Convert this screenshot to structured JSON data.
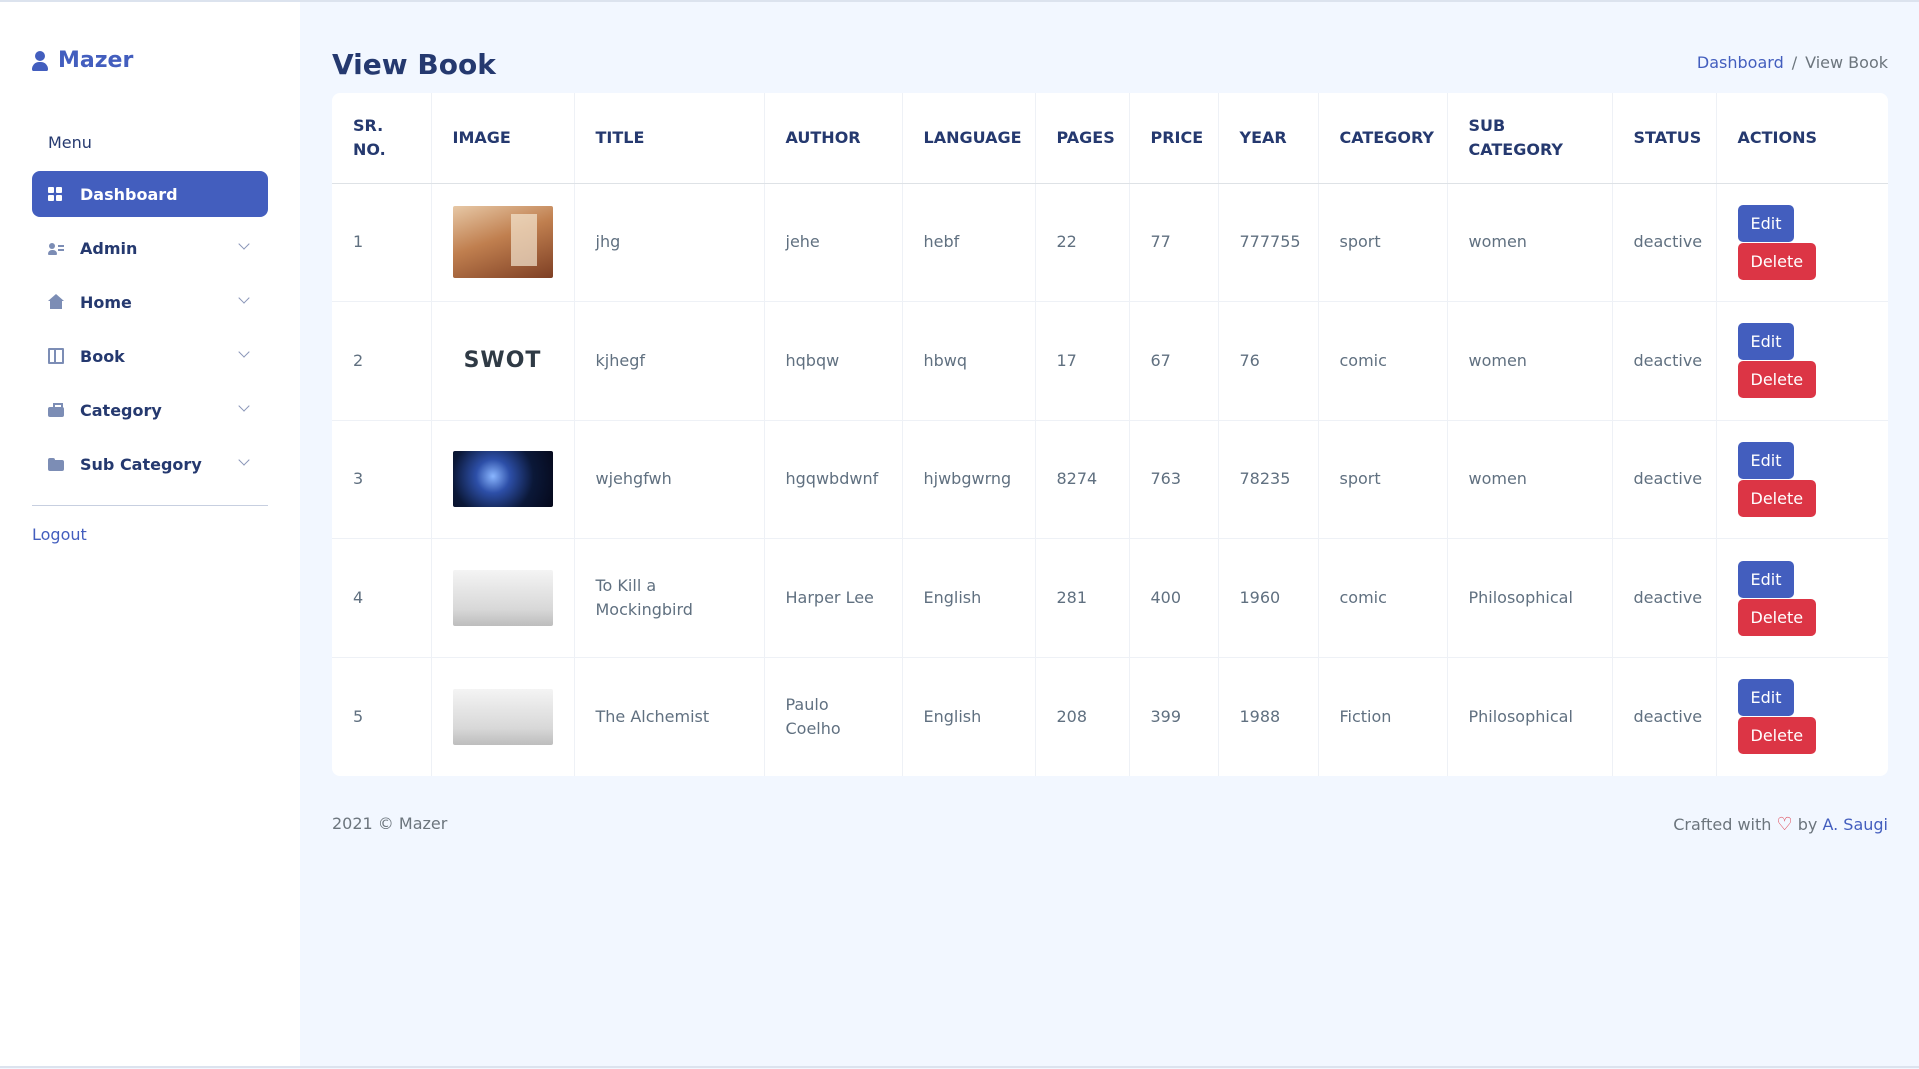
{
  "brand": {
    "name": "Mazer"
  },
  "sidebar": {
    "menu_title": "Menu",
    "items": [
      {
        "label": "Dashboard",
        "icon": "grid-icon",
        "active": true
      },
      {
        "label": "Admin",
        "icon": "admin-icon"
      },
      {
        "label": "Home",
        "icon": "home-icon"
      },
      {
        "label": "Book",
        "icon": "book-icon"
      },
      {
        "label": "Category",
        "icon": "briefcase-icon"
      },
      {
        "label": "Sub Category",
        "icon": "folder-icon"
      }
    ],
    "logout": "Logout"
  },
  "page": {
    "title": "View Book",
    "breadcrumb": {
      "home": "Dashboard",
      "current": "View Book"
    }
  },
  "table": {
    "headers": [
      "SR. NO.",
      "IMAGE",
      "TITLE",
      "AUTHOR",
      "LANGUAGE",
      "PAGES",
      "PRICE",
      "YEAR",
      "CATEGORY",
      "SUB CATEGORY",
      "STATUS",
      "ACTIONS"
    ],
    "edit_label": "Edit",
    "delete_label": "Delete",
    "rows": [
      {
        "sr": "1",
        "image": "room-photo",
        "title": "jhg",
        "author": "jehe",
        "language": "hebf",
        "pages": "22",
        "price": "77",
        "year": "777755",
        "category": "sport",
        "subcategory": "women",
        "status": "deactive"
      },
      {
        "sr": "2",
        "image": "swot-graphic",
        "title": "kjhegf",
        "author": "hqbqw",
        "language": "hbwq",
        "pages": "17",
        "price": "67",
        "year": "76",
        "category": "comic",
        "subcategory": "women",
        "status": "deactive"
      },
      {
        "sr": "3",
        "image": "space-photo",
        "title": "wjehgfwh",
        "author": "hgqwbdwnf",
        "language": "hjwbgwrng",
        "pages": "8274",
        "price": "763",
        "year": "78235",
        "category": "sport",
        "subcategory": "women",
        "status": "deactive"
      },
      {
        "sr": "4",
        "image": "foggy-tree-photo",
        "title": "To Kill a Mockingbird",
        "author": "Harper Lee",
        "language": "English",
        "pages": "281",
        "price": "400",
        "year": "1960",
        "category": "comic",
        "subcategory": "Philosophical",
        "status": "deactive"
      },
      {
        "sr": "5",
        "image": "foggy-tree-photo",
        "title": "The Alchemist",
        "author": "Paulo Coelho",
        "language": "English",
        "pages": "208",
        "price": "399",
        "year": "1988",
        "category": "Fiction",
        "subcategory": "Philosophical",
        "status": "deactive"
      }
    ]
  },
  "footer": {
    "left": "2021 © Mazer",
    "crafted": "Crafted with",
    "by": "by",
    "author": "A. Saugi"
  },
  "colors": {
    "primary": "#435ebe",
    "danger": "#dc3545",
    "background": "#f2f7ff"
  }
}
